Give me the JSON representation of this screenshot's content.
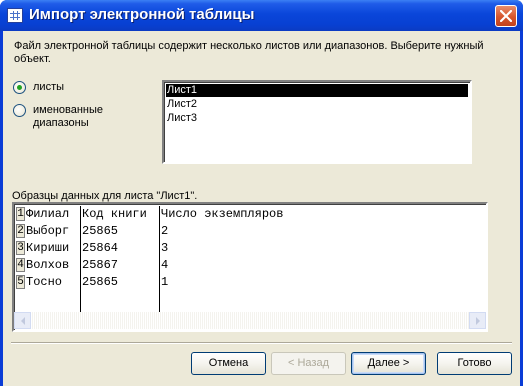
{
  "window": {
    "title": "Импорт электронной таблицы"
  },
  "instructions": "Файл электронной таблицы содержит несколько листов или диапазонов. Выберите нужный объект.",
  "options": {
    "sheets": {
      "label": "листы",
      "checked": true
    },
    "ranges": {
      "label": "именованные диапазоны",
      "checked": false
    }
  },
  "sheet_list": {
    "items": [
      "Лист1",
      "Лист2",
      "Лист3"
    ],
    "selected": "Лист1"
  },
  "preview": {
    "label": "Образцы данных для листа \"Лист1\".",
    "columns": [
      "Филиал",
      "Код книги",
      "Число экземпляров"
    ],
    "rows": [
      {
        "num": "1",
        "cells": [
          "Филиал",
          "Код книги",
          "Число экземпляров"
        ]
      },
      {
        "num": "2",
        "cells": [
          "Выборг",
          "25865",
          "2"
        ]
      },
      {
        "num": "3",
        "cells": [
          "Кириши",
          "25864",
          "3"
        ]
      },
      {
        "num": "4",
        "cells": [
          "Волхов",
          "25867",
          "4"
        ]
      },
      {
        "num": "5",
        "cells": [
          "Тосно",
          "25865",
          "1"
        ]
      }
    ]
  },
  "buttons": {
    "cancel": "Отмена",
    "back": "< Назад",
    "next": "Далее >",
    "finish": "Готово"
  },
  "icons": {
    "title": "spreadsheet-icon",
    "close": "close-icon",
    "scroll_left": "arrow-left-icon",
    "scroll_right": "arrow-right-icon"
  },
  "colors": {
    "titlebar": "#0a46da",
    "dialog": "#ece9d8",
    "selection": "#000000",
    "radio_dot": "#21a121"
  }
}
